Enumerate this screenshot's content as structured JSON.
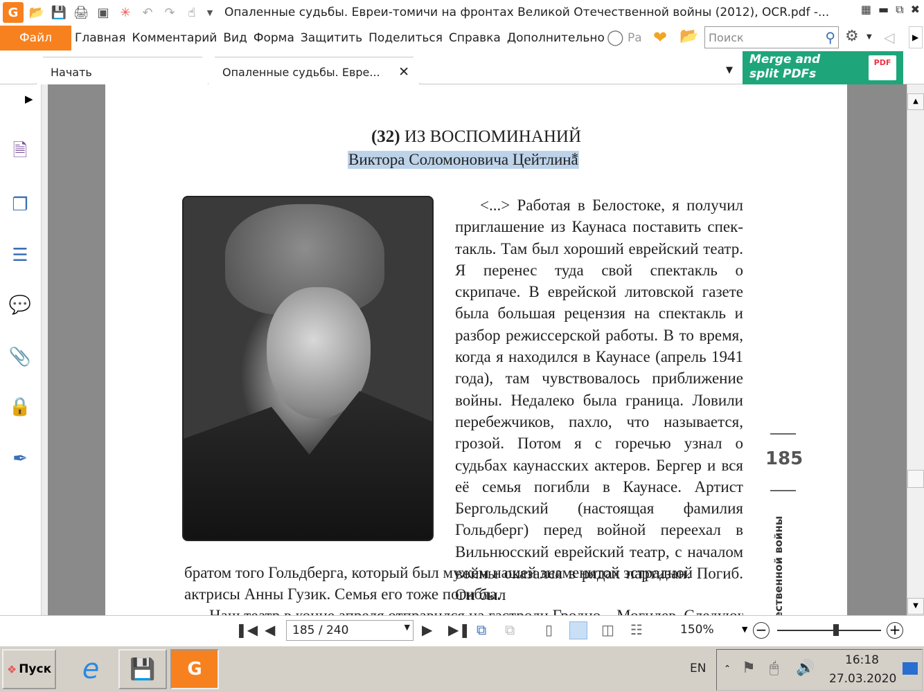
{
  "window": {
    "title": "Опаленные судьбы. Евреи-томичи на фронтах Великой Отечественной войны (2012), OCR.pdf -...",
    "app_logo": "G"
  },
  "menu": {
    "file": "Файл",
    "items": [
      "Главная",
      "Комментарий",
      "Вид",
      "Форма",
      "Защитить",
      "Поделиться",
      "Справка",
      "Дополнительно"
    ],
    "tell_me": "Ра",
    "search_placeholder": "Поиск"
  },
  "tabs": {
    "start": "Начать",
    "document": "Опаленные судьбы. Евре..."
  },
  "ad": {
    "line1": "Merge and",
    "line2": "split PDFs",
    "badge": "PDF"
  },
  "document": {
    "heading_num": "(32)",
    "heading": "ИЗ ВОСПОМИНАНИЙ",
    "subheading": "Виктора Соломоновича Цейтлина",
    "star": "*",
    "paragraph_right": "<...> Работая в Белостоке, я получил приглашение из Каунаса поставить спек­такль. Там был хороший еврейский театр. Я перенес туда свой спектакль о скрипаче. В еврейской литовской газете была боль­шая рецензия на спектакль и разбор режис­серской работы. В то время, когда я нахо­дился в Каунасе (апрель 1941 года), там чувствовалось приближение войны. Неда­леко была граница. Ловили перебежчиков, пахло, что называется, грозой. Потом я с го­речью узнал о судьбах каунасских актеров. Бергер и вся её семья погибли в Каунасе. Артист Бергольдский (настоящая фамилия Гольдберг) перед войной переехал в Виль­нюсский еврейский театр, с началом войны оказался в рядах партизан. Погиб. Он был",
    "paragraph_wide": "братом того Гольдберга, который был мужем нашей знаменитой эстрадной актрисы Анны Гузик. Семья его тоже погибла.",
    "paragraph_cut": "Наш театр в конце апреля отправился на гастроли Гродно – Могилев. Следующим",
    "page_number": "185",
    "side_title": "ественной войны"
  },
  "nav": {
    "page_field": "185 / 240",
    "zoom": "150%"
  },
  "taskbar": {
    "start": "Пуск",
    "lang": "EN",
    "time": "16:18",
    "date": "27.03.2020"
  }
}
